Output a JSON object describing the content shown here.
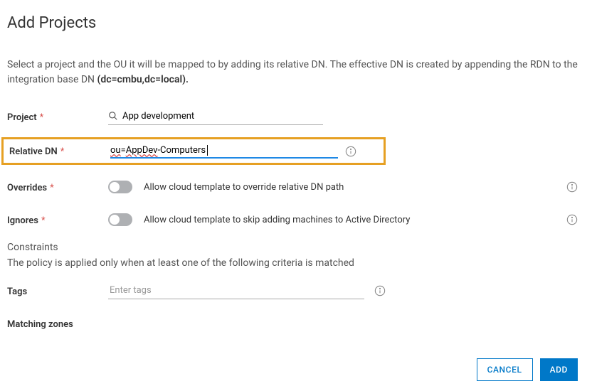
{
  "title": "Add Projects",
  "intro_pre": "Select a project and the OU it will be mapped to by adding its relative DN. The effective DN is created by appending the RDN to the integration base DN ",
  "intro_bold": "(dc=cmbu,dc=local).",
  "fields": {
    "project": {
      "label": "Project",
      "value": "App development"
    },
    "relative_dn": {
      "label": "Relative DN",
      "value": "ou=AppDev-Computers"
    },
    "overrides": {
      "label": "Overrides",
      "desc": "Allow cloud template to override relative DN path",
      "on": false
    },
    "ignores": {
      "label": "Ignores",
      "desc": "Allow cloud template to skip adding machines to Active Directory",
      "on": false
    },
    "tags": {
      "label": "Tags",
      "placeholder": "Enter tags"
    },
    "matching_zones": {
      "label": "Matching zones"
    }
  },
  "constraints": {
    "heading": "Constraints",
    "sub": "The policy is applied only when at least one of the following criteria is matched"
  },
  "buttons": {
    "cancel": "CANCEL",
    "add": "ADD"
  }
}
